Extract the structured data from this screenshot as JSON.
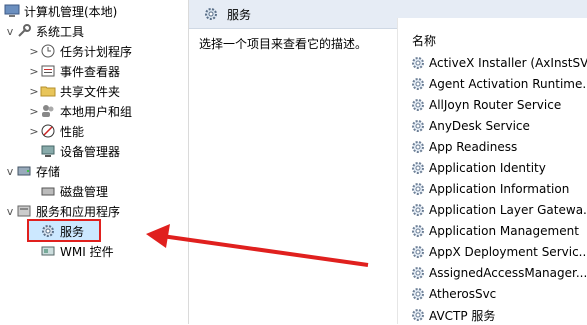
{
  "tree": {
    "root_label": "计算机管理(本地)",
    "items": [
      {
        "label": "系统工具",
        "chevron": "v",
        "icon": "tools-icon"
      },
      {
        "label": "任务计划程序",
        "chevron": ">",
        "icon": "clock-icon"
      },
      {
        "label": "事件查看器",
        "chevron": ">",
        "icon": "event-viewer-icon"
      },
      {
        "label": "共享文件夹",
        "chevron": ">",
        "icon": "shared-folder-icon"
      },
      {
        "label": "本地用户和组",
        "chevron": ">",
        "icon": "users-icon"
      },
      {
        "label": "性能",
        "chevron": ">",
        "icon": "performance-icon"
      },
      {
        "label": "设备管理器",
        "chevron": "",
        "icon": "device-manager-icon"
      },
      {
        "label": "存储",
        "chevron": "v",
        "icon": "storage-icon"
      },
      {
        "label": "磁盘管理",
        "chevron": "",
        "icon": "disk-icon"
      },
      {
        "label": "服务和应用程序",
        "chevron": "v",
        "icon": "services-apps-icon"
      },
      {
        "label": "服务",
        "chevron": "",
        "icon": "gear-icon"
      },
      {
        "label": "WMI 控件",
        "chevron": "",
        "icon": "wmi-icon"
      }
    ]
  },
  "panel": {
    "header_title": "服务",
    "description": "选择一个项目来查看它的描述。",
    "column_name": "名称",
    "services": [
      "ActiveX Installer (AxInstSV)",
      "Agent Activation Runtime...",
      "AllJoyn Router Service",
      "AnyDesk Service",
      "App Readiness",
      "Application Identity",
      "Application Information",
      "Application Layer Gatewa...",
      "Application Management",
      "AppX Deployment Servic...",
      "AssignedAccessManager...",
      "AtherosSvc",
      "AVCTP 服务"
    ]
  },
  "colors": {
    "accent_red": "#e0201e",
    "selection": "#cce8ff",
    "header_bg": "#e6ecf5"
  }
}
